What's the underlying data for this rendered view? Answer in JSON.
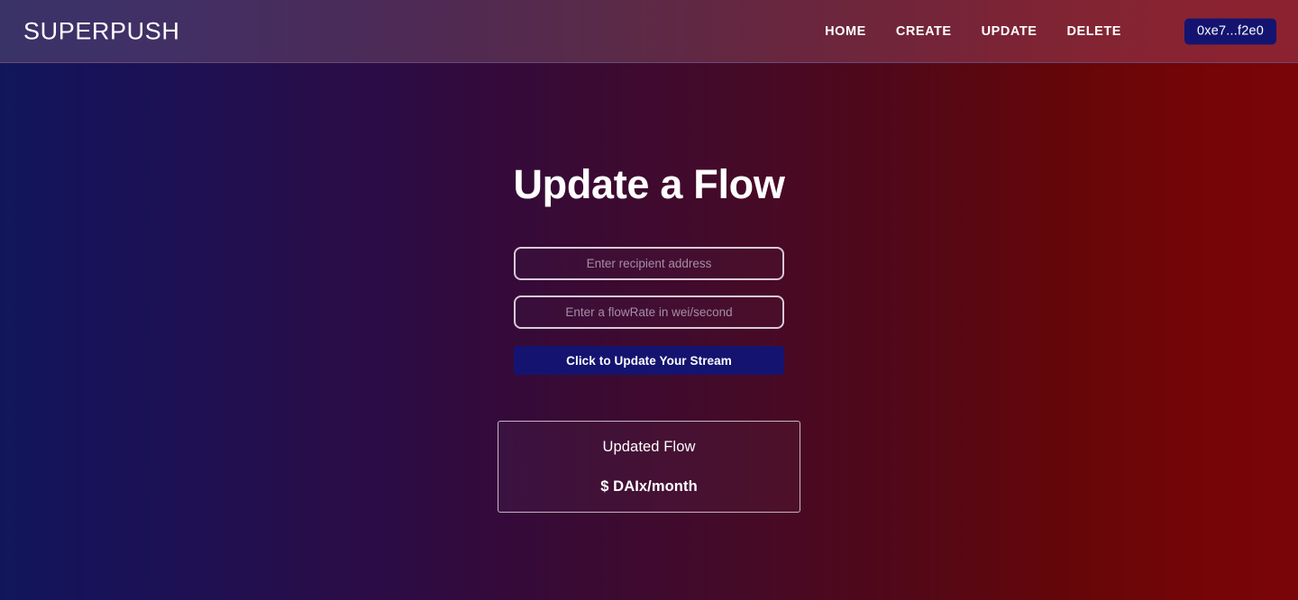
{
  "header": {
    "brand": "SUPERPUSH",
    "nav_items": [
      {
        "label": "HOME"
      },
      {
        "label": "CREATE"
      },
      {
        "label": "UPDATE"
      },
      {
        "label": "DELETE"
      }
    ],
    "wallet": {
      "label": "0xe7...f2e0",
      "background": "#141470"
    },
    "gradient_from": "#3a3368",
    "gradient_to": "#8c2230"
  },
  "main": {
    "title": "Update a Flow",
    "form": {
      "recipient": {
        "value": "",
        "placeholder": "Enter recipient address"
      },
      "flow_rate": {
        "value": "",
        "placeholder": "Enter a flowRate in wei/second"
      },
      "submit_label": "Click to Update Your Stream"
    },
    "result_card": {
      "label": "Updated Flow",
      "value": "$ DAIx/month"
    }
  },
  "theme": {
    "body_gradient_from": "#11165a",
    "body_gradient_to": "#7a0508",
    "accent": "#141470",
    "border": "#d9cad8",
    "placeholder": "#a58da6",
    "text": "#ffffff"
  }
}
